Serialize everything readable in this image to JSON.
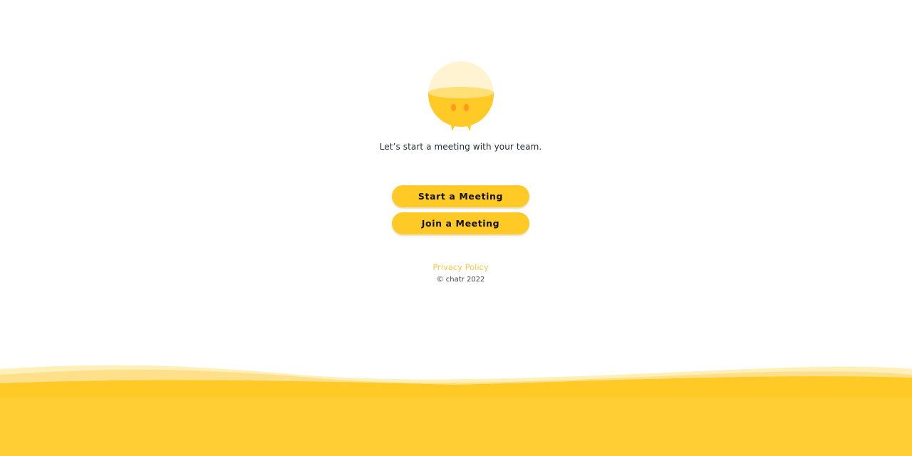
{
  "hero": {
    "mascot_icon": "smiling-bulb-mascot-icon",
    "tagline": "Let’s start a meeting with your team."
  },
  "actions": {
    "start_label": "Start a Meeting",
    "join_label": "Join a Meeting"
  },
  "footer": {
    "privacy_label": "Privacy Policy",
    "copyright": "© chatr 2022"
  },
  "colors": {
    "accent": "#ffc926",
    "accent_light": "#fff3d1",
    "eyes": "#ff9a1a",
    "link": "#f7c84a",
    "text": "#1f2a30",
    "background": "#ffffff"
  }
}
